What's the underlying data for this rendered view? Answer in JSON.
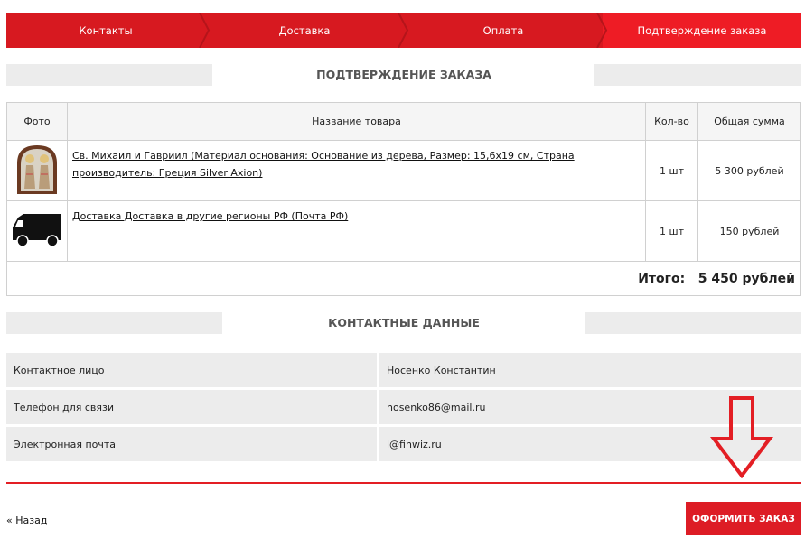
{
  "steps": [
    {
      "label": "Контакты",
      "active": false
    },
    {
      "label": "Доставка",
      "active": false
    },
    {
      "label": "Оплата",
      "active": false
    },
    {
      "label": "Подтверждение заказа",
      "active": true
    }
  ],
  "order": {
    "heading": "ПОДТВЕРЖДЕНИЕ ЗАКАЗА",
    "columns": {
      "photo": "Фото",
      "name": "Название товара",
      "qty": "Кол-во",
      "sum": "Общая сумма"
    },
    "items": [
      {
        "image": "icon-image",
        "name": "Св. Михаил и Гавриил (Материал основания: Основание из дерева, Размер: 15,6х19 см, Страна производитель: Греция Silver Axion)",
        "qty": "1 шт",
        "sum": "5 300 рублей"
      },
      {
        "image": "truck-icon",
        "name": "Доставка Доставка в другие регионы РФ (Почта РФ)",
        "qty": "1 шт",
        "sum": "150 рублей"
      }
    ],
    "total_label": "Итого:",
    "total_value": "5 450 рублей"
  },
  "contacts": {
    "heading": "КОНТАКТНЫЕ ДАННЫЕ",
    "rows": [
      {
        "label": "Контактное лицо",
        "value": "Носенко Константин"
      },
      {
        "label": "Телефон для связи",
        "value": "nosenko86@mail.ru"
      },
      {
        "label": "Электронная почта",
        "value": "l@finwiz.ru"
      }
    ]
  },
  "nav": {
    "back_label": "« Назад",
    "submit_label": "ОФОРМИТЬ ЗАКАЗ"
  },
  "colors": {
    "accent": "#e31e24",
    "step_bg": "#d71920",
    "step_active": "#ee1c25"
  }
}
